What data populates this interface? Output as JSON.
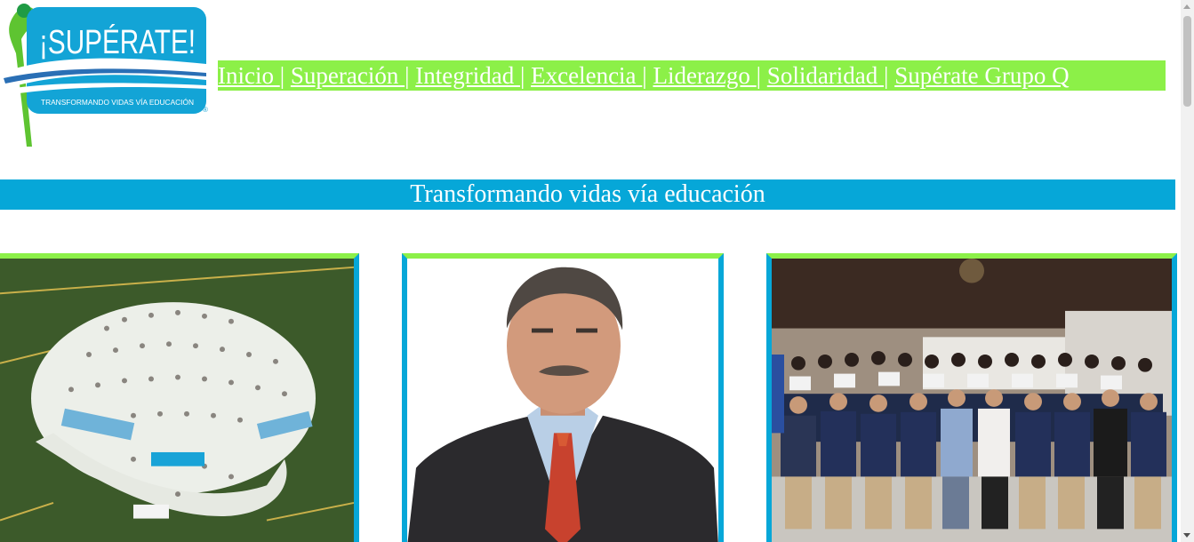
{
  "logo": {
    "title": "¡SUPÉRATE!",
    "tagline": "TRANSFORMANDO VIDAS VÍA EDUCACIÓN",
    "mark": "®"
  },
  "nav": {
    "items": [
      {
        "label": "Inicio "
      },
      {
        "label": "Superación "
      },
      {
        "label": "Integridad "
      },
      {
        "label": "Excelencia "
      },
      {
        "label": "Liderazgo "
      },
      {
        "label": "Solidaridad "
      },
      {
        "label": "Supérate Grupo Q"
      }
    ],
    "separator": "|"
  },
  "banner": {
    "text": "Transformando vidas vía educación"
  },
  "photos": [
    {
      "subject": "group-photo-on-field"
    },
    {
      "subject": "portrait-man-in-suit"
    },
    {
      "subject": "graduation-group-photo"
    }
  ],
  "colors": {
    "nav_bg": "#8cf048",
    "banner_bg": "#06a7d8",
    "card_top_border": "#8cf048",
    "card_side_border": "#06a7d8",
    "logo_blue": "#13a4d6",
    "logo_green": "#5ec431"
  }
}
